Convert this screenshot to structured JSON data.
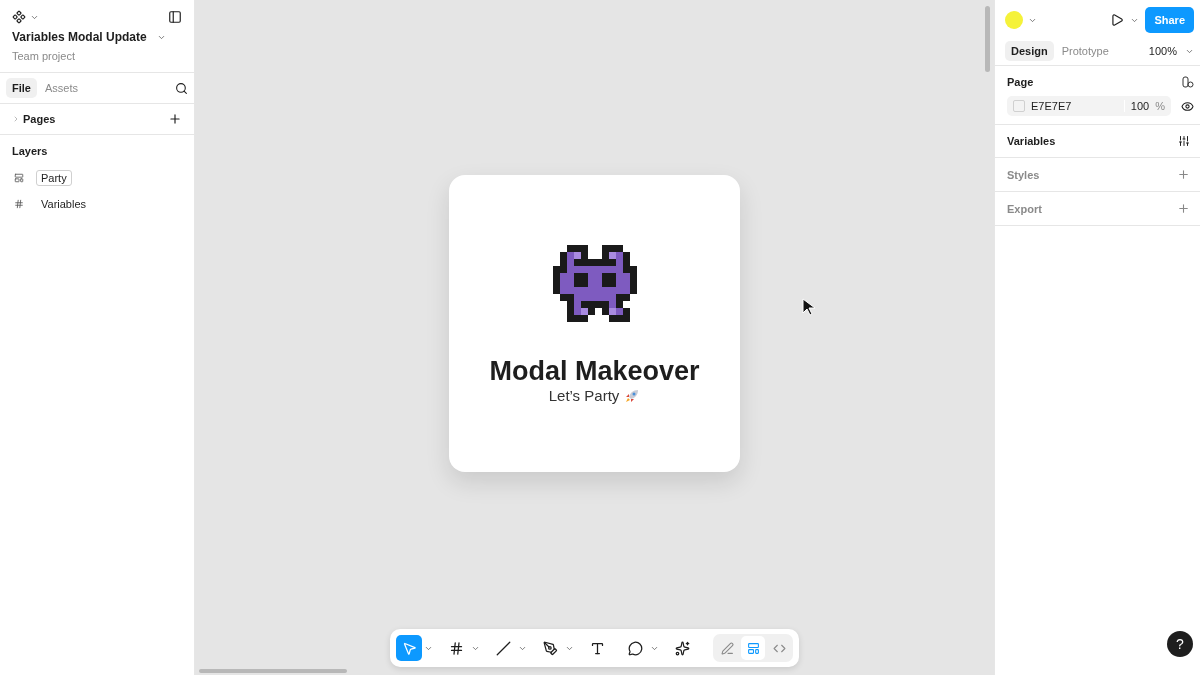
{
  "file": {
    "title": "Variables Modal Update",
    "subtitle": "Team project"
  },
  "left_tabs": [
    {
      "label": "File",
      "selected": true
    },
    {
      "label": "Assets",
      "selected": false
    }
  ],
  "pages": {
    "label": "Pages",
    "expanded": false
  },
  "layers": {
    "label": "Layers",
    "items": [
      {
        "name": "Party",
        "kind": "group",
        "editing": true
      },
      {
        "name": "Variables",
        "kind": "frame",
        "editing": false
      }
    ]
  },
  "card": {
    "title": "Modal Makeover",
    "subtitle": "Let’s Party"
  },
  "toolbar": {
    "tools": [
      {
        "kind": "move",
        "selected": true,
        "menu": true
      },
      {
        "kind": "frame",
        "selected": false,
        "menu": true
      },
      {
        "kind": "line",
        "selected": false,
        "menu": true
      },
      {
        "kind": "pen",
        "selected": false,
        "menu": true
      },
      {
        "kind": "text",
        "selected": false,
        "menu": false
      },
      {
        "kind": "comment",
        "selected": false,
        "menu": true
      },
      {
        "kind": "ai",
        "selected": false,
        "menu": false
      }
    ],
    "modes": [
      {
        "kind": "draw",
        "selected": false
      },
      {
        "kind": "design",
        "selected": true
      },
      {
        "kind": "dev",
        "selected": false
      }
    ]
  },
  "right": {
    "share": "Share",
    "tabs": [
      {
        "label": "Design",
        "selected": true
      },
      {
        "label": "Prototype",
        "selected": false
      }
    ],
    "zoom": "100%",
    "page": {
      "title": "Page",
      "fill": "E7E7E7",
      "opacity": "100",
      "unit": "%"
    },
    "sections": [
      {
        "title": "Variables",
        "kind": "settings",
        "muted": false
      },
      {
        "title": "Styles",
        "kind": "add",
        "muted": true
      },
      {
        "title": "Export",
        "kind": "add",
        "muted": true
      }
    ]
  },
  "help": "?"
}
